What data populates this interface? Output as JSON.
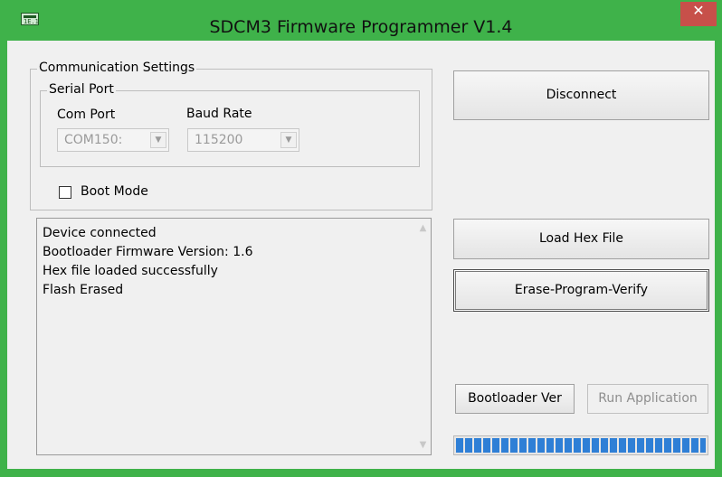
{
  "window": {
    "title": "SDCM3 Firmware Programmer V1.4",
    "app_icon_text": "1E.1",
    "close_glyph": "✕"
  },
  "communication": {
    "group_label": "Communication Settings",
    "serial_group_label": "Serial Port",
    "com_port_label": "Com Port",
    "com_port_value": "COM150:",
    "baud_rate_label": "Baud Rate",
    "baud_rate_value": "115200",
    "boot_mode_label": "Boot Mode",
    "boot_mode_checked": false
  },
  "buttons": {
    "disconnect": "Disconnect",
    "load_hex": "Load Hex File",
    "erase_program_verify": "Erase-Program-Verify",
    "bootloader_ver": "Bootloader Ver",
    "run_application": "Run Application"
  },
  "log": {
    "lines": [
      "Device connected",
      "Bootloader Firmware Version: 1.6",
      "Hex file loaded successfully",
      "Flash Erased"
    ]
  },
  "progress": {
    "value_percent": 100,
    "color": "#2e7fd6"
  },
  "colors": {
    "title_bar": "#3fb24a",
    "close_button": "#c7504a"
  },
  "icons": {
    "dropdown_arrow": "▼",
    "scroll_up": "▲",
    "scroll_down": "▼"
  }
}
